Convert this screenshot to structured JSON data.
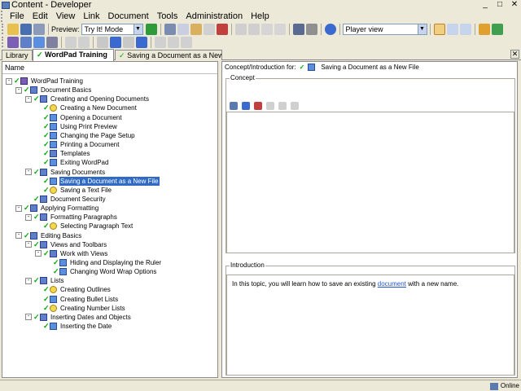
{
  "window": {
    "title": "Content - Developer"
  },
  "menu": [
    "File",
    "Edit",
    "View",
    "Link",
    "Document",
    "Tools",
    "Administration",
    "Help"
  ],
  "toolbar": {
    "preview_label": "Preview:",
    "preview_mode": "Try It! Mode",
    "view_mode": "Player view"
  },
  "tabs": {
    "library": "Library",
    "outline": "WordPad Training",
    "topic": "Saving a Document as a New ..."
  },
  "tree_header": "Name",
  "tree": [
    {
      "label": "WordPad Training",
      "icon": "book-icon",
      "level": 0,
      "exp": "-",
      "chk": true
    },
    {
      "label": "Document Basics",
      "icon": "section-icon",
      "level": 1,
      "exp": "-",
      "chk": true
    },
    {
      "label": "Creating and Opening Documents",
      "icon": "section-icon",
      "level": 2,
      "exp": "-",
      "chk": true
    },
    {
      "label": "Creating a New Document",
      "icon": "bulb-icon",
      "level": 3,
      "exp": "",
      "chk": true
    },
    {
      "label": "Opening a Document",
      "icon": "doc-icon",
      "level": 3,
      "exp": "",
      "chk": true
    },
    {
      "label": "Using Print Preview",
      "icon": "doc-icon",
      "level": 3,
      "exp": "",
      "chk": true
    },
    {
      "label": "Changing the Page Setup",
      "icon": "doc-icon",
      "level": 3,
      "exp": "",
      "chk": true
    },
    {
      "label": "Printing a Document",
      "icon": "doc-icon",
      "level": 3,
      "exp": "",
      "chk": true
    },
    {
      "label": "Templates",
      "icon": "section-icon",
      "level": 3,
      "exp": "",
      "chk": true
    },
    {
      "label": "Exiting WordPad",
      "icon": "doc-icon",
      "level": 3,
      "exp": "",
      "chk": true
    },
    {
      "label": "Saving Documents",
      "icon": "section-icon",
      "level": 2,
      "exp": "-",
      "chk": true
    },
    {
      "label": "Saving a Document as a New File",
      "icon": "doc-icon",
      "level": 3,
      "exp": "",
      "chk": true,
      "selected": true
    },
    {
      "label": "Saving a Text File",
      "icon": "bulb-icon",
      "level": 3,
      "exp": "",
      "chk": true
    },
    {
      "label": "Document Security",
      "icon": "section-icon",
      "level": 2,
      "exp": "",
      "chk": true
    },
    {
      "label": "Applying Formatting",
      "icon": "section-icon",
      "level": 1,
      "exp": "-",
      "chk": true
    },
    {
      "label": "Formatting Paragraphs",
      "icon": "section-icon",
      "level": 2,
      "exp": "-",
      "chk": true
    },
    {
      "label": "Selecting Paragraph Text",
      "icon": "bulb-icon",
      "level": 3,
      "exp": "",
      "chk": true
    },
    {
      "label": "Editing Basics",
      "icon": "section-icon",
      "level": 1,
      "exp": "-",
      "chk": true
    },
    {
      "label": "Views and Toolbars",
      "icon": "section-icon",
      "level": 2,
      "exp": "-",
      "chk": true
    },
    {
      "label": "Work with Views",
      "icon": "section-icon",
      "level": 3,
      "exp": "-",
      "chk": true
    },
    {
      "label": "Hiding and Displaying the Ruler",
      "icon": "doc-icon",
      "level": 4,
      "exp": "",
      "chk": true
    },
    {
      "label": "Changing Word Wrap Options",
      "icon": "doc-icon",
      "level": 4,
      "exp": "",
      "chk": true
    },
    {
      "label": "Lists",
      "icon": "section-icon",
      "level": 2,
      "exp": "-",
      "chk": true
    },
    {
      "label": "Creating Outlines",
      "icon": "bulb-icon",
      "level": 3,
      "exp": "",
      "chk": true
    },
    {
      "label": "Creating Bullet Lists",
      "icon": "doc-icon",
      "level": 3,
      "exp": "",
      "chk": true
    },
    {
      "label": "Creating Number Lists",
      "icon": "bulb-icon",
      "level": 3,
      "exp": "",
      "chk": true
    },
    {
      "label": "Inserting Dates and Objects",
      "icon": "section-icon",
      "level": 2,
      "exp": "-",
      "chk": true
    },
    {
      "label": "Inserting the Date",
      "icon": "doc-icon",
      "level": 3,
      "exp": "",
      "chk": true
    }
  ],
  "right": {
    "header_prefix": "Concept/Introduction for:",
    "header_topic": "Saving a Document as a New File",
    "concept_label": "Concept",
    "intro_label": "Introduction",
    "intro_before": "In this topic, you will learn how to save an existing ",
    "intro_link": "document",
    "intro_after": " with a new name."
  },
  "status": {
    "online": "Online"
  }
}
